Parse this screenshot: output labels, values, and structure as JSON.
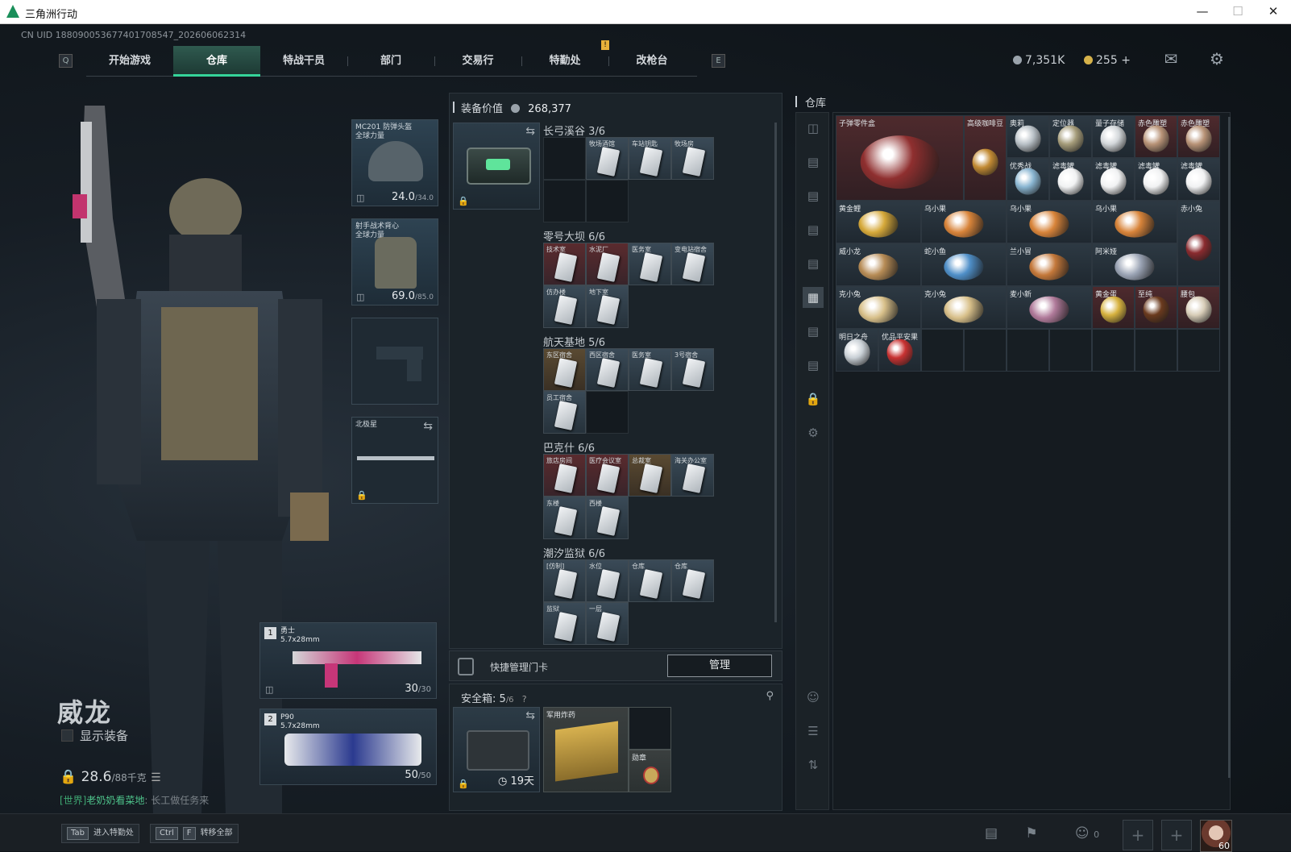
{
  "window": {
    "title": "三角洲行动"
  },
  "uid": "CN UID 188090053677401708547_202606062314",
  "nav": {
    "key_left": "Q",
    "key_right": "E",
    "tabs": [
      "开始游戏",
      "仓库",
      "特战干员",
      "部门",
      "交易行",
      "特勤处",
      "改枪台"
    ],
    "active": "仓库",
    "notif": "!"
  },
  "currency": {
    "silver": "7,351K",
    "gold": "255",
    "plus": "+"
  },
  "player": {
    "name": "威龙",
    "show_equipment": "显示装备",
    "weight_current": "28.6",
    "weight_max": "/88千克"
  },
  "chat": {
    "channel": "[世界]",
    "user": "老奶奶看菜地",
    "text": "长工做任务来"
  },
  "gear": {
    "helmet": {
      "label": "MC201 防弹头盔",
      "sub": "全球力量",
      "value": "24.0",
      "max": "/34.0"
    },
    "armor": {
      "label": "射手战术背心",
      "sub": "全球力量",
      "value": "69.0",
      "max": "/85.0"
    },
    "melee": {
      "label": "北极星"
    }
  },
  "weapons": [
    {
      "num": "1",
      "name": "勇士",
      "sub": "5.7x28mm",
      "ammo": "30",
      "max": "/30"
    },
    {
      "num": "2",
      "name": "P90",
      "sub": "5.7x28mm",
      "ammo": "50",
      "max": "/50"
    }
  ],
  "bottom": {
    "tab_key": "Tab",
    "tab_label": "进入特勤处",
    "ctrl_key": "Ctrl",
    "f_key": "F",
    "transfer_label": "转移全部",
    "friends": "0",
    "level": "60"
  },
  "middle": {
    "title": "装备价值",
    "value": "268,377",
    "groups": [
      {
        "title": "长弓溪谷 3/6",
        "cards": [
          "牧场酒馆",
          "车站钥匙",
          "牧场房"
        ]
      },
      {
        "title": "零号大坝 6/6",
        "cards": [
          "技术室",
          "水泥厂",
          "医务室",
          "变电站宿舍",
          "仿办楼",
          "地下室"
        ]
      },
      {
        "title": "航天基地 5/6",
        "cards": [
          "东区宿舍",
          "西区宿舍",
          "医务室",
          "3号宿舍",
          "员工宿舍"
        ]
      },
      {
        "title": "巴克什 6/6",
        "cards": [
          "旅店房间",
          "医疗会议室",
          "总裁室",
          "海关办公室",
          "东楼",
          "西楼"
        ]
      },
      {
        "title": "潮汐监狱 6/6",
        "cards": [
          "[仿制]",
          "水位",
          "仓库",
          "仓库",
          "监狱",
          "一层"
        ]
      }
    ],
    "quick_manage": "快捷管理门卡",
    "manage_btn": "管理",
    "safe_label": "安全箱:",
    "safe_count": "5",
    "safe_max": "/6",
    "safe_q": "?",
    "safe_days": "19天",
    "safe_items": [
      "军用炸药",
      "勋章"
    ]
  },
  "warehouse": {
    "title": "仓库",
    "items": [
      "子弹零件盒",
      "高级咖啡豆",
      "奥莉",
      "定位器",
      "量子存储",
      "赤色雕塑",
      "赤色雕塑",
      "优秀战",
      "滤毒罐",
      "滤毒罐",
      "滤毒罐",
      "滤毒罐",
      "黄金鲤",
      "乌小果",
      "乌小果",
      "乌小果",
      "赤小兔",
      "威小龙",
      "蛇小鱼",
      "兰小冒",
      "阿米娅",
      "克小兔",
      "克小兔",
      "麦小新",
      "黄金蛋",
      "至纯",
      "腰包",
      "明日之舟",
      "优品平安果"
    ]
  }
}
